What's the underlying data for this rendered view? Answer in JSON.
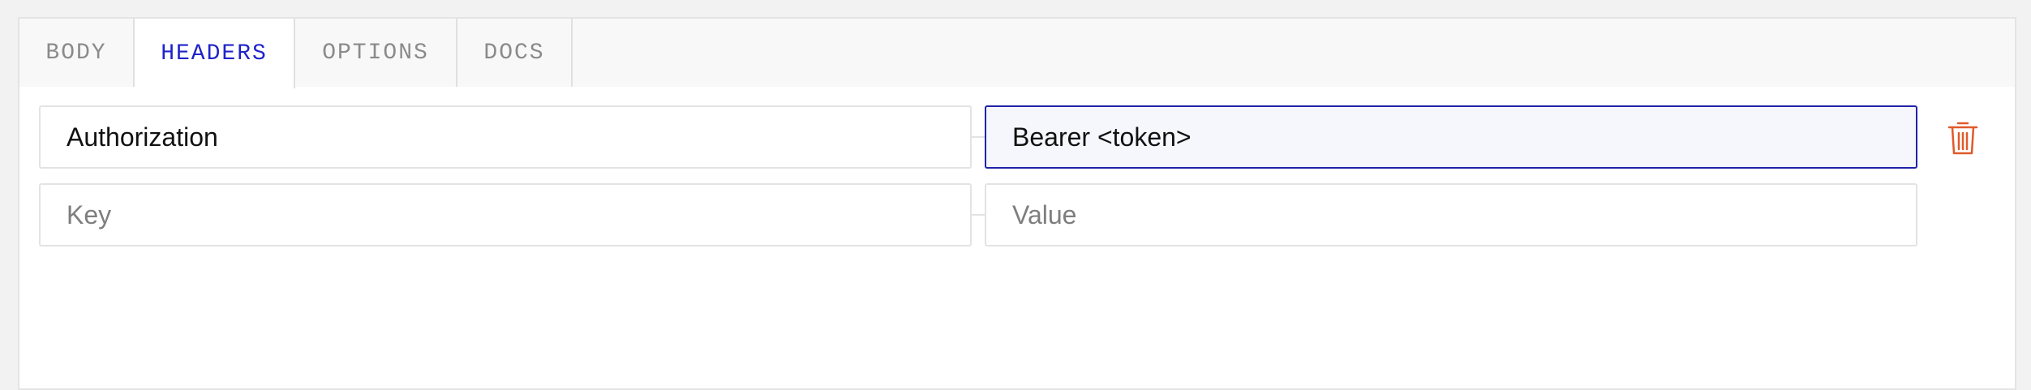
{
  "tabs": [
    {
      "label": "BODY"
    },
    {
      "label": "HEADERS",
      "active": true
    },
    {
      "label": "OPTIONS"
    },
    {
      "label": "DOCS"
    }
  ],
  "headers": {
    "rows": [
      {
        "key": "Authorization",
        "value": "Bearer <token>"
      },
      {
        "key": "",
        "value": ""
      }
    ],
    "key_placeholder": "Key",
    "value_placeholder": "Value"
  },
  "icons": {
    "delete": "trash-icon"
  },
  "colors": {
    "active_tab": "#1f23c8",
    "focus_border": "#1f23a8",
    "delete_icon": "#e05a2b"
  }
}
